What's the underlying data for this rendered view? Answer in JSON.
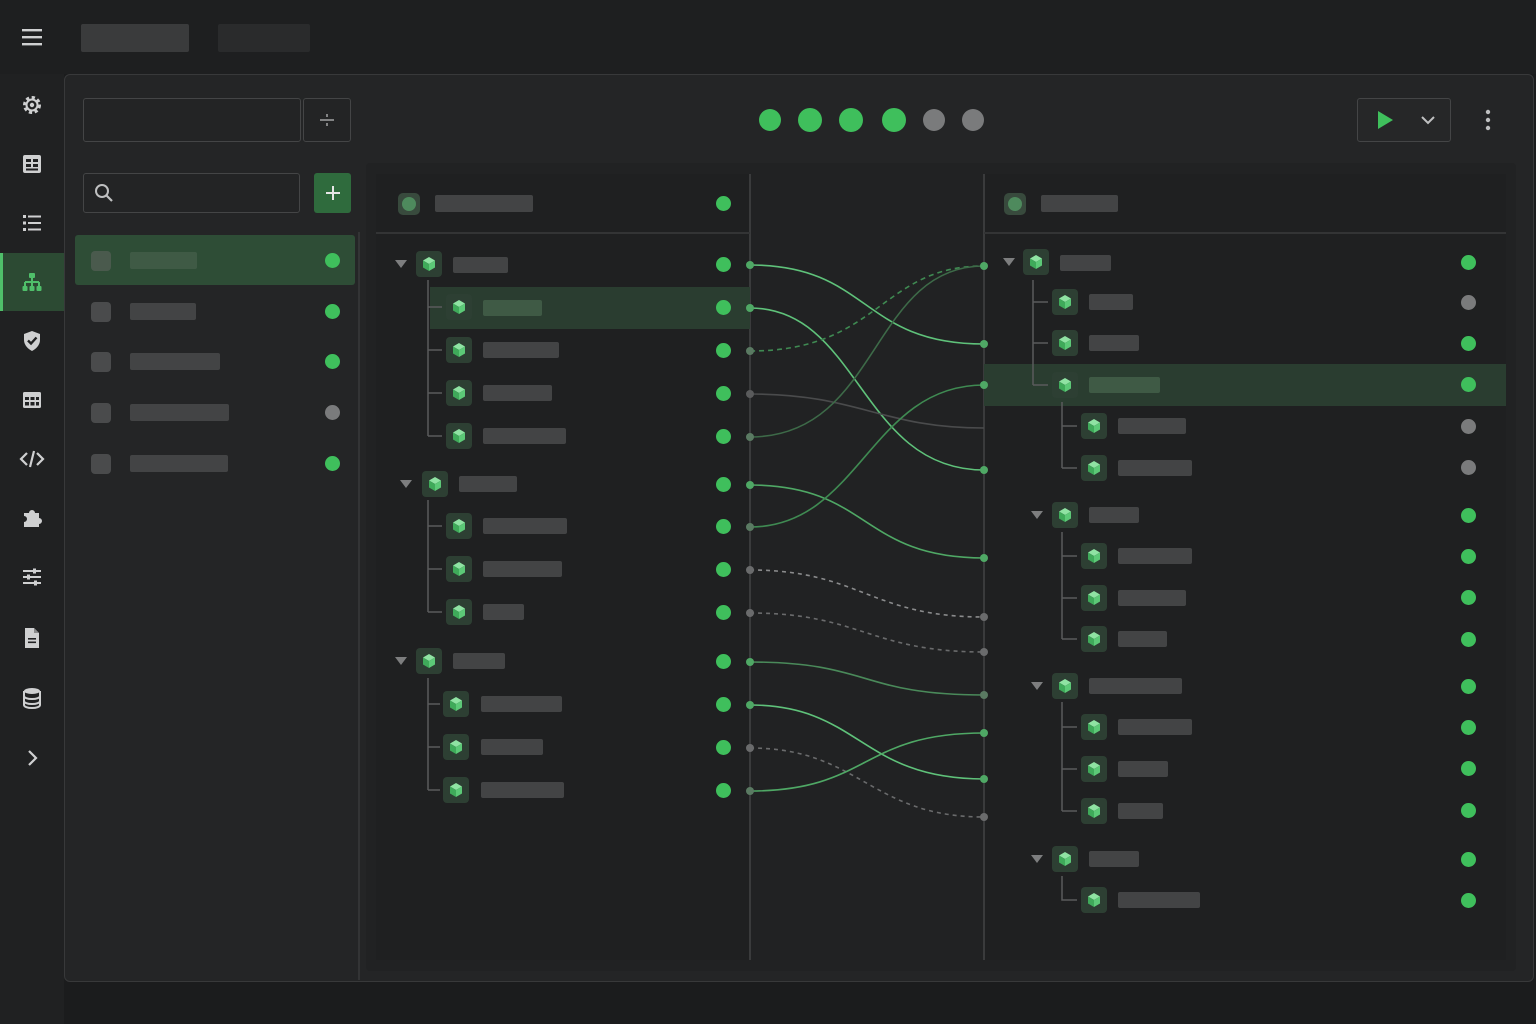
{
  "accent": "#3fbf5c",
  "topbar": {
    "menu_icon": "hamburger-icon"
  },
  "rail": {
    "items": [
      {
        "name": "settings",
        "icon": "gear-icon"
      },
      {
        "name": "tables",
        "icon": "grid-icon"
      },
      {
        "name": "list",
        "icon": "list-icon"
      },
      {
        "name": "mapping",
        "icon": "hierarchy-icon",
        "active": true
      },
      {
        "name": "security",
        "icon": "shield-check-icon"
      },
      {
        "name": "data-table",
        "icon": "table-icon"
      },
      {
        "name": "code",
        "icon": "code-icon"
      },
      {
        "name": "plugins",
        "icon": "puzzle-icon"
      },
      {
        "name": "adjustments",
        "icon": "sliders-icon"
      },
      {
        "name": "documents",
        "icon": "file-icon"
      },
      {
        "name": "database",
        "icon": "database-icon"
      },
      {
        "name": "expand",
        "icon": "chevron-right-icon"
      }
    ]
  },
  "toolbar": {
    "name_input_value": "",
    "step_indicators": [
      true,
      true,
      true,
      true,
      false,
      false
    ],
    "run_icon": "play-icon",
    "run_menu_icon": "chevron-down-icon",
    "more_icon": "kebab-icon"
  },
  "sidebar": {
    "search_value": "",
    "items": [
      {
        "status": true,
        "active": true
      },
      {
        "status": true
      },
      {
        "status": true
      },
      {
        "status": false
      },
      {
        "status": true
      }
    ]
  },
  "source_tree": {
    "header_status": true
  },
  "target_tree": {
    "header_status": true
  }
}
